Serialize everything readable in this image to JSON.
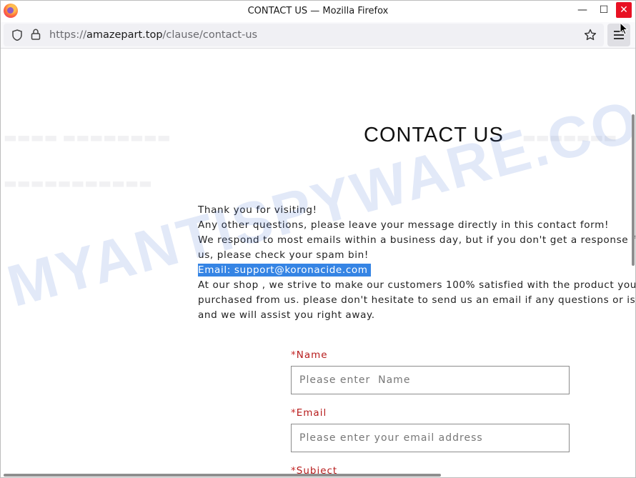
{
  "window": {
    "title": "CONTACT US — Mozilla Firefox",
    "minimize_glyph": "—",
    "maximize_glyph": "☐",
    "close_glyph": "✕"
  },
  "navbar": {
    "url_prefix": "https://",
    "url_host": "amazepart.top",
    "url_path": "/clause/contact-us"
  },
  "page": {
    "title": "CONTACT US",
    "intro_lines": [
      "Thank you for visiting!",
      "Any other questions, please leave your message directly in this contact form!",
      "We respond to most emails within a business day, but if you don't get a response from",
      "us, please check your spam bin!",
      "Email: support@koronacide.com",
      "At our shop , we strive to make our customers 100% satisfied with the product you",
      "purchased from us. please don't hesitate to send us an email if any questions or issues,",
      "and we will assist you right away."
    ]
  },
  "form": {
    "required_mark": "*",
    "name_label": "Name",
    "name_placeholder": "Please enter  Name",
    "email_label": "Email",
    "email_placeholder": "Please enter your email address",
    "subject_label": "Subject"
  },
  "watermark": "MYANTISPYWARE.COM",
  "colors": {
    "required": "#c62828",
    "selection": "#3584e4",
    "close_button": "#e81123"
  },
  "icons": [
    "firefox-logo",
    "shield-icon",
    "lock-icon",
    "star-icon",
    "menu-icon",
    "cursor-icon"
  ]
}
